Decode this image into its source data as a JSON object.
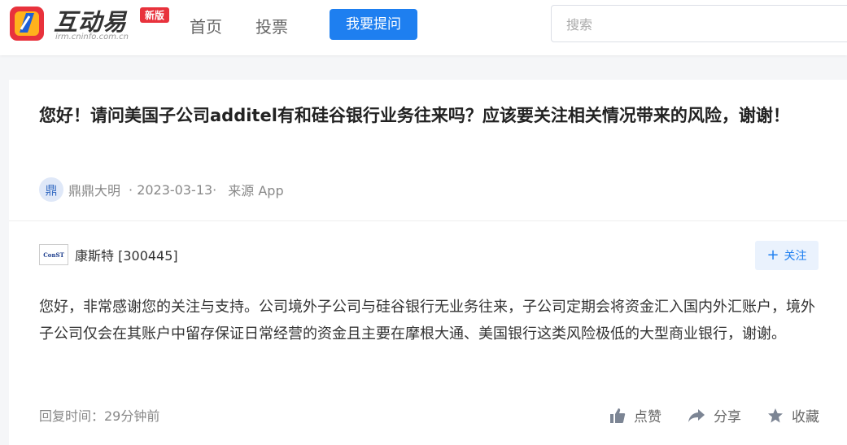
{
  "header": {
    "logo_text": "互动易",
    "logo_url": "irm.cninfo.com.cn",
    "logo_badge": "新版",
    "nav": [
      "首页",
      "投票"
    ],
    "ask_button": "我要提问",
    "search_placeholder": "搜索"
  },
  "question": {
    "title": "您好！请问美国子公司additel有和硅谷银行业务往来吗？应该要关注相关情况带来的风险，谢谢！",
    "avatar_char": "鼎",
    "user": "鼎鼎大明",
    "date": "· 2023-03-13·",
    "source": "来源 App"
  },
  "answer": {
    "company_logo_text": "ConST",
    "company": "康斯特 [300445]",
    "follow_label": "关注",
    "text": "您好，非常感谢您的关注与支持。公司境外子公司与硅谷银行无业务往来，子公司定期会将资金汇入国内外汇账户，境外子公司仅会在其账户中留存保证日常经营的资金且主要在摩根大通、美国银行这类风险极低的大型商业银行，谢谢。",
    "reply_time": "回复时间：29分钟前",
    "like_label": "点赞",
    "share_label": "分享",
    "favorite_label": "收藏"
  },
  "colors": {
    "accent": "#1e7ff0",
    "badge": "#e8323c"
  },
  "icons": [
    "logo-mark-icon",
    "plus-icon",
    "thumbs-up-icon",
    "share-arrow-icon",
    "star-icon"
  ]
}
